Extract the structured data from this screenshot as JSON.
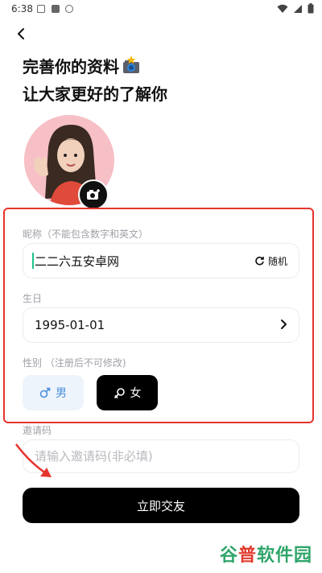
{
  "status_bar": {
    "time": "6:38"
  },
  "heading": {
    "line1": "完善你的资料",
    "line2": "让大家更好的了解你"
  },
  "nickname": {
    "label": "昵称（不能包含数字和英文）",
    "value": "二二六五安卓网",
    "random_label": "随机"
  },
  "birthday": {
    "label": "生日",
    "value": "1995-01-01"
  },
  "gender": {
    "label": "性别 （注册后不可修改)",
    "male_label": "男",
    "female_label": "女",
    "selected": "女"
  },
  "invite": {
    "label": "邀请码",
    "placeholder": "请输入邀请码(非必填)"
  },
  "submit": {
    "label": "立即交友"
  },
  "watermark": {
    "part1": "谷",
    "part2": "普",
    "part3": "软件园"
  },
  "colors": {
    "annotation_red": "#e5342d",
    "accent_green": "#1ec28b",
    "male_blue": "#4a8fdc",
    "avatar_pink": "#f6c0c6"
  },
  "icons": [
    "back-icon",
    "camera-emoji-icon",
    "camera-icon",
    "refresh-icon",
    "chevron-right-icon",
    "male-icon",
    "female-icon",
    "arrow-annotation-icon",
    "wifi-icon",
    "signal-icon",
    "battery-icon"
  ]
}
